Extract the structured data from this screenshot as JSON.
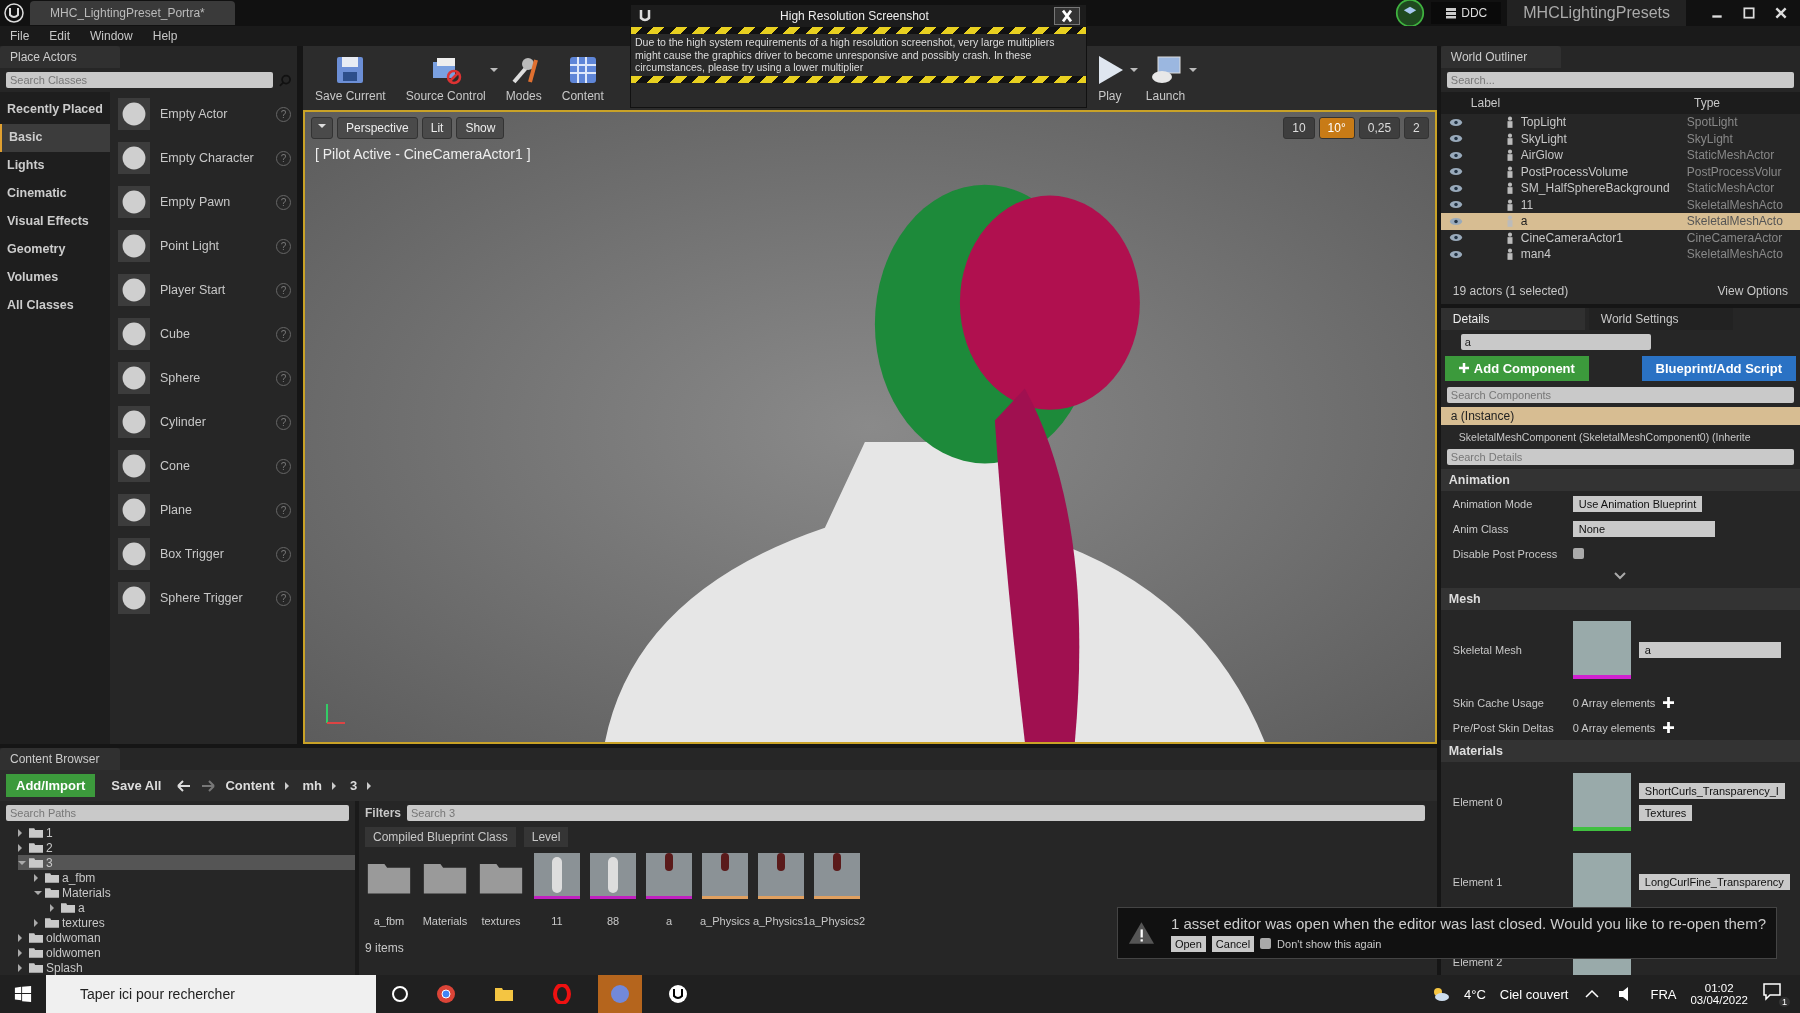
{
  "title_bar": {
    "tab": "MHC_LightingPreset_Portra*",
    "ddc": "DDC",
    "project": "MHCLightingPresets"
  },
  "menu": [
    "File",
    "Edit",
    "Window",
    "Help"
  ],
  "place_actors": {
    "title": "Place Actors",
    "placeholder": "Search Classes",
    "categories": [
      {
        "label": "Recently Placed",
        "selected": false
      },
      {
        "label": "Basic",
        "selected": true
      },
      {
        "label": "Lights",
        "selected": false
      },
      {
        "label": "Cinematic",
        "selected": false
      },
      {
        "label": "Visual Effects",
        "selected": false
      },
      {
        "label": "Geometry",
        "selected": false
      },
      {
        "label": "Volumes",
        "selected": false
      },
      {
        "label": "All Classes",
        "selected": false
      }
    ],
    "help": "?",
    "items": [
      "Empty Actor",
      "Empty Character",
      "Empty Pawn",
      "Point Light",
      "Player Start",
      "Cube",
      "Sphere",
      "Cylinder",
      "Cone",
      "Plane",
      "Box Trigger",
      "Sphere Trigger"
    ]
  },
  "toolbar": [
    {
      "label": "Save Current",
      "kind": "save",
      "dropdown": false
    },
    {
      "label": "Source Control",
      "kind": "source",
      "dropdown": true
    },
    {
      "label": "Modes",
      "kind": "modes",
      "dropdown": false
    },
    {
      "label": "Content",
      "kind": "content",
      "dropdown": false
    },
    {
      "label": "Play",
      "kind": "play",
      "dropdown": true
    },
    {
      "label": "Launch",
      "kind": "launch",
      "dropdown": true
    }
  ],
  "screenshot_dialog": {
    "title": "High Resolution Screenshot",
    "message": "Due to the high system requirements of a high resolution screenshot, very large multipliers might cause the graphics driver to become unresponsive and possibly crash. In these circumstances, please try using a lower multiplier"
  },
  "viewport": {
    "view_buttons": [
      "Perspective",
      "Lit",
      "Show"
    ],
    "pilot": "[ Pilot Active - CineCameraActor1 ]",
    "snaps": [
      {
        "value": "10",
        "on": false
      },
      {
        "value": "10°",
        "on": true
      },
      {
        "value": "0,25",
        "on": false
      },
      {
        "value": "2",
        "on": false
      }
    ]
  },
  "world_outliner": {
    "title": "World Outliner",
    "placeholder": "Search...",
    "columns": [
      "Label",
      "Type"
    ],
    "rows": [
      {
        "label": "TopLight",
        "type": "SpotLight",
        "selected": false
      },
      {
        "label": "SkyLight",
        "type": "SkyLight",
        "selected": false
      },
      {
        "label": "AirGlow",
        "type": "StaticMeshActor",
        "selected": false
      },
      {
        "label": "PostProcessVolume",
        "type": "PostProcessVolur",
        "selected": false
      },
      {
        "label": "SM_HalfSphereBackground",
        "type": "StaticMeshActor",
        "selected": false
      },
      {
        "label": "11",
        "type": "SkeletalMeshActo",
        "selected": false
      },
      {
        "label": "a",
        "type": "SkeletalMeshActo",
        "selected": true
      },
      {
        "label": "CineCameraActor1",
        "type": "CineCameraActor",
        "selected": false
      },
      {
        "label": "man4",
        "type": "SkeletalMeshActo",
        "selected": false
      }
    ],
    "count": "19 actors (1 selected)",
    "view_options": "View Options"
  },
  "details": {
    "tabs": [
      {
        "label": "Details",
        "selected": true
      },
      {
        "label": "World Settings",
        "selected": false
      }
    ],
    "name": "a",
    "add_component": "Add Component",
    "blueprint": "Blueprint/Add Script",
    "components_placeholder": "Search Components",
    "components": [
      {
        "label": "a (Instance)",
        "selected": true
      },
      {
        "label": "SkeletalMeshComponent (SkeletalMeshComponent0) (Inherite",
        "selected": false
      }
    ],
    "details_placeholder": "Search Details",
    "sections": [
      {
        "title": "Animation",
        "rows": [
          {
            "kind": "dropdown",
            "label": "Animation Mode",
            "value": "Use Animation Blueprint"
          },
          {
            "kind": "picker",
            "label": "Anim Class",
            "value": "None"
          },
          {
            "kind": "checkbox",
            "label": "Disable Post Process",
            "checked": false
          }
        ]
      },
      {
        "title": "Mesh",
        "rows": [
          {
            "kind": "asset",
            "label": "Skeletal Mesh",
            "value": "a",
            "color": "#d020d0"
          },
          {
            "kind": "array",
            "label": "Skin Cache Usage",
            "value": "0 Array elements"
          },
          {
            "kind": "array",
            "label": "Pre/Post Skin Deltas",
            "value": "0 Array elements"
          }
        ]
      },
      {
        "title": "Materials",
        "rows": [
          {
            "kind": "material",
            "label": "Element 0",
            "value": "ShortCurls_Transparency_I",
            "extra": "Textures",
            "color": "#40c040"
          },
          {
            "kind": "material",
            "label": "Element 1",
            "value": "LongCurlFine_Transparency"
          },
          {
            "kind": "material",
            "label": "Element 2"
          }
        ]
      }
    ]
  },
  "content_browser": {
    "title": "Content Browser",
    "add_import": "Add/Import",
    "save_all": "Save All",
    "path": [
      "Content",
      "mh",
      "3"
    ],
    "paths_placeholder": "Search Paths",
    "tree": [
      {
        "label": "1",
        "expanded": false,
        "selected": false
      },
      {
        "label": "2",
        "expanded": false,
        "selected": false
      },
      {
        "label": "3",
        "expanded": true,
        "selected": true,
        "children": [
          {
            "label": "a_fbm",
            "expanded": false,
            "selected": false
          },
          {
            "label": "Materials",
            "expanded": true,
            "selected": false,
            "children": [
              {
                "label": "a",
                "expanded": false,
                "selected": false
              }
            ]
          },
          {
            "label": "textures",
            "expanded": false,
            "selected": false
          }
        ]
      },
      {
        "label": "oldwoman",
        "expanded": false,
        "selected": false
      },
      {
        "label": "oldwomen",
        "expanded": false,
        "selected": false
      },
      {
        "label": "Splash",
        "expanded": false,
        "selected": false
      }
    ],
    "filters": "Filters",
    "placeholder": "Search 3",
    "chips": [
      "Compiled Blueprint Class",
      "Level"
    ],
    "assets": [
      {
        "label": "a_fbm",
        "kind": "folder"
      },
      {
        "label": "Materials",
        "kind": "folder"
      },
      {
        "label": "textures",
        "kind": "folder"
      },
      {
        "label": "11",
        "kind": "mesh",
        "color": "#c020c0"
      },
      {
        "label": "88",
        "kind": "mesh",
        "color": "#c020c0"
      },
      {
        "label": "a",
        "kind": "hair",
        "color": "#c020c0"
      },
      {
        "label": "a_Physics",
        "kind": "hair",
        "color": "#e0a060"
      },
      {
        "label": "a_Physics1",
        "kind": "hair",
        "color": "#e0a060"
      },
      {
        "label": "a_Physics2",
        "kind": "hair",
        "color": "#e0a060"
      }
    ],
    "count": "9 items"
  },
  "notification": {
    "message": "1 asset editor was open when the editor was last closed. Would you like to re-open them?",
    "buttons": [
      "Open",
      "Cancel"
    ],
    "checkbox": "Don't show this again",
    "checked": false
  },
  "taskbar": {
    "placeholder": "Taper ici pour rechercher",
    "apps": [
      {
        "kind": "browser",
        "active": false
      },
      {
        "kind": "folder",
        "active": false
      },
      {
        "kind": "opera",
        "active": false
      },
      {
        "kind": "chat",
        "active": true
      },
      {
        "kind": "unreal",
        "active": false
      }
    ],
    "temperature": "4°C",
    "weather": "Ciel couvert",
    "language": "FRA",
    "time": "01:02",
    "date": "03/04/2022",
    "notifications": "1"
  }
}
